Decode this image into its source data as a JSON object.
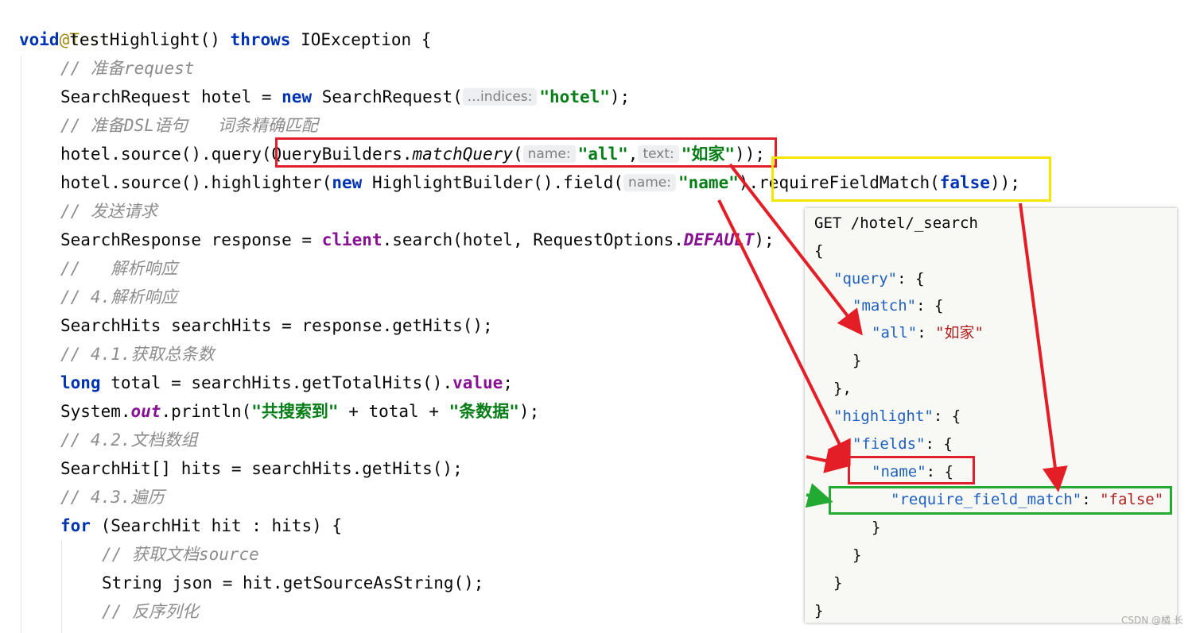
{
  "code": {
    "annotation": "@Test",
    "method_sig": {
      "kw_void": "void",
      "name": "testHighlight()",
      "kw_throws": "throws",
      "rest": "IOException {"
    },
    "comment_prepare_request": "// 准备request",
    "line_search_request": {
      "t1": "SearchRequest hotel = ",
      "kw_new": "new",
      "t2": "SearchRequest(",
      "hint": "...indices:",
      "str": "\"hotel\"",
      "t3": ");"
    },
    "comment_prepare_dsl": "// 准备DSL语句   词条精确匹配",
    "line_query": {
      "t1": "hotel.source().query(",
      "t2": "QueryBuilders.",
      "method": "matchQuery",
      "t3": "(",
      "hint1": "name:",
      "str1": "\"all\"",
      "comma": ",",
      "hint2": "text:",
      "str2": "\"如家\"",
      "t4": ")",
      "t5": ");"
    },
    "line_highlight": {
      "t1": "hotel.source().highlighter(",
      "kw_new": "new",
      "t2": "HighlightBuilder().field(",
      "hint": "name:",
      "str": "\"name\"",
      "t3": ")",
      "t4": ".requireFieldMatch(",
      "kw_false": "false",
      "t5": "));"
    },
    "comment_send": "// 发送请求",
    "line_response": {
      "t1": "SearchResponse response = ",
      "field": "client",
      "t2": ".search(hotel, RequestOptions.",
      "const": "DEFAULT",
      "t3": ");"
    },
    "comment_parse": "//   解析响应",
    "comment_parse4": "// 4.解析响应",
    "line_hits": "SearchHits searchHits = response.getHits();",
    "comment_total": "// 4.1.获取总条数",
    "line_total": {
      "kw_long": "long",
      "t1": " total = searchHits.getTotalHits().",
      "field": "value",
      "t2": ";"
    },
    "line_println": {
      "t1": "System.",
      "field": "out",
      "t2": ".println(",
      "str1": "\"共搜索到\"",
      "t3": " + total + ",
      "str2": "\"条数据\"",
      "t4": ");"
    },
    "comment_docs": "// 4.2.文档数组",
    "line_hit_array": "SearchHit[] hits = searchHits.getHits();",
    "comment_iterate": "// 4.3.遍历",
    "line_for": {
      "kw_for": "for",
      "t1": " (SearchHit hit : hits) {"
    },
    "comment_source": "// 获取文档source",
    "line_json": "String json = hit.getSourceAsString();",
    "comment_deserialize": "// 反序列化"
  },
  "json_panel": {
    "request": "GET /hotel/_search",
    "open_brace": "{",
    "query_key": "\"query\"",
    "match_key": "\"match\"",
    "all_key": "\"all\"",
    "all_value": "\"如家\"",
    "close_inner": "}",
    "close_query": "},",
    "highlight_key": "\"highlight\"",
    "fields_key": "\"fields\"",
    "name_key": "\"name\"",
    "rfm_key": "\"require_field_match\"",
    "rfm_value": "\"false\"",
    "close_brace": "}",
    "colon_brace": ": {",
    "colon": ": "
  },
  "watermark": "CSDN @橘 长",
  "colors": {
    "red_box": "#e0202a",
    "yellow_box": "#f5e600",
    "green_box": "#22aa33",
    "arrow_red": "#e41e26",
    "arrow_green": "#22aa33"
  }
}
